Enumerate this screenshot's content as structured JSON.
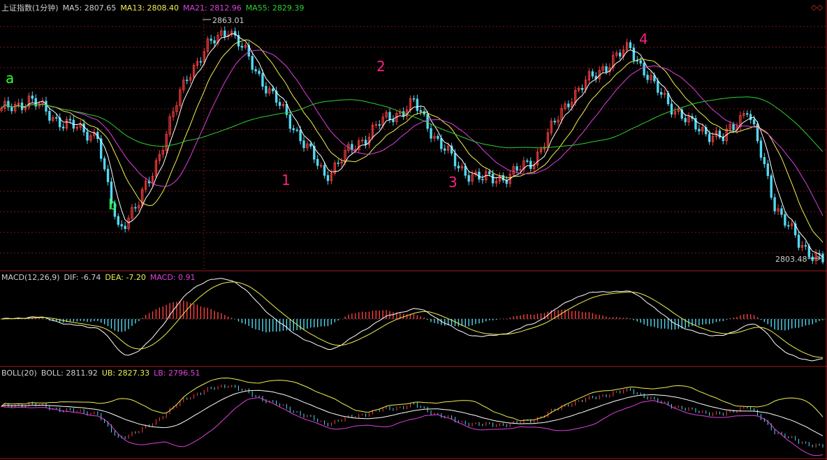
{
  "colors": {
    "background": "#000000",
    "panel_border": "#a01818",
    "grid": "#7a1414",
    "up_candle": "#ff4040",
    "down_candle": "#54d8f0",
    "ma5": "#ffffff",
    "ma13": "#f0f050",
    "ma21": "#e040e0",
    "ma55": "#30d030",
    "label_green": "#30ff30",
    "label_magenta": "#ff2080",
    "text_default": "#d0d0d0"
  },
  "header": {
    "title": "上证指数(1分钟)",
    "ma5": "MA5: 2807.65",
    "ma13": "MA13: 2808.40",
    "ma21": "MA21: 2812.96",
    "ma55": "MA55: 2829.39",
    "corner_icon": "diamond-outline-icon"
  },
  "macd_header": {
    "title": "MACD(12,26,9)",
    "dif": "DIF: -6.74",
    "dea": "DEA: -7.20",
    "macd": "MACD: 0.91"
  },
  "boll_header": {
    "title": "BOLL(20)",
    "boll": "BOLL: 2811.92",
    "ub": "UB: 2827.33",
    "lb": "LB: 2796.51"
  },
  "price_panel": {
    "high_label": "2863.01",
    "low_label": "2803.48",
    "ylim": [
      2802,
      2866
    ]
  },
  "wave_labels": {
    "a": "a",
    "b": "b",
    "one": "1",
    "two": "2",
    "three": "3",
    "four": "4"
  },
  "chart_data": {
    "type": "line",
    "x_count": 240,
    "series_keyframes": [
      [
        0,
        2841
      ],
      [
        8,
        2844
      ],
      [
        18,
        2838
      ],
      [
        28,
        2835
      ],
      [
        30,
        2825
      ],
      [
        34,
        2812
      ],
      [
        40,
        2818
      ],
      [
        44,
        2826
      ],
      [
        54,
        2850
      ],
      [
        60,
        2857
      ],
      [
        66,
        2862
      ],
      [
        72,
        2854
      ],
      [
        78,
        2846
      ],
      [
        86,
        2836
      ],
      [
        94,
        2825
      ],
      [
        100,
        2830
      ],
      [
        110,
        2838
      ],
      [
        120,
        2843
      ],
      [
        126,
        2835
      ],
      [
        133,
        2827
      ],
      [
        140,
        2824
      ],
      [
        148,
        2825
      ],
      [
        155,
        2829
      ],
      [
        165,
        2844
      ],
      [
        175,
        2852
      ],
      [
        183,
        2857
      ],
      [
        190,
        2847
      ],
      [
        200,
        2838
      ],
      [
        210,
        2834
      ],
      [
        217,
        2842
      ],
      [
        225,
        2818
      ],
      [
        232,
        2808
      ],
      [
        239,
        2804
      ]
    ],
    "ma_periods": [
      5,
      13,
      21,
      55
    ],
    "macd_params": [
      12,
      26,
      9
    ],
    "boll_params": [
      20,
      2
    ]
  }
}
